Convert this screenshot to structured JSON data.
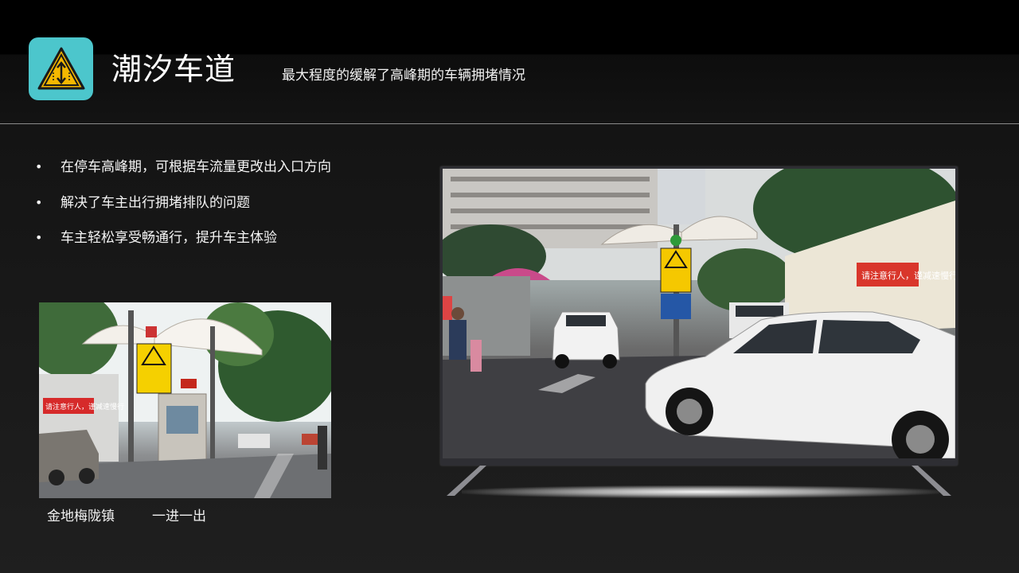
{
  "header": {
    "title": "潮汐车道",
    "subtitle": "最大程度的缓解了高峰期的车辆拥堵情况",
    "icon": "tidal-lane-warning-icon",
    "icon_bg_color": "#4cc6cc",
    "icon_accent_color": "#f5b800"
  },
  "bullets": [
    "在停车高峰期，可根据车流量更改出入口方向",
    "解决了车主出行拥堵排队的问题",
    "车主轻松享受畅通行，提升车主体验"
  ],
  "photo_left": {
    "sign_banner_text": "请注意行人，谨减速慢行",
    "caption_location": "金地梅陇镇",
    "caption_mode": "一进一出"
  },
  "tv_photo": {
    "banner_text": "请注意行人，谨减速慢行"
  }
}
